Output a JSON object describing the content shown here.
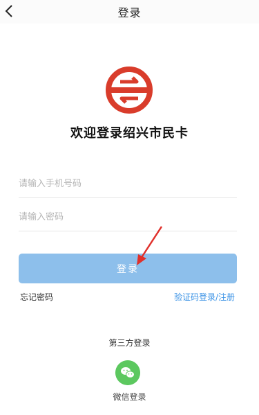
{
  "header": {
    "title": "登录",
    "back_icon": "chevron-left-icon"
  },
  "logo": {
    "name": "citizen-card-logo-icon",
    "color": "#d93c2b"
  },
  "welcome_text": "欢迎登录绍兴市民卡",
  "form": {
    "phone_placeholder": "请输入手机号码",
    "password_placeholder": "请输入密码",
    "login_label": "登录"
  },
  "links": {
    "forgot_password": "忘记密码",
    "sms_login_register": "验证码登录/注册"
  },
  "third_party": {
    "title": "第三方登录",
    "wechat_label": "微信登录",
    "wechat_icon": "wechat-icon"
  },
  "colors": {
    "accent": "#3b93e6",
    "button": "#8dbfeb",
    "wechat": "#5cc85f",
    "arrow": "#e0302b"
  }
}
